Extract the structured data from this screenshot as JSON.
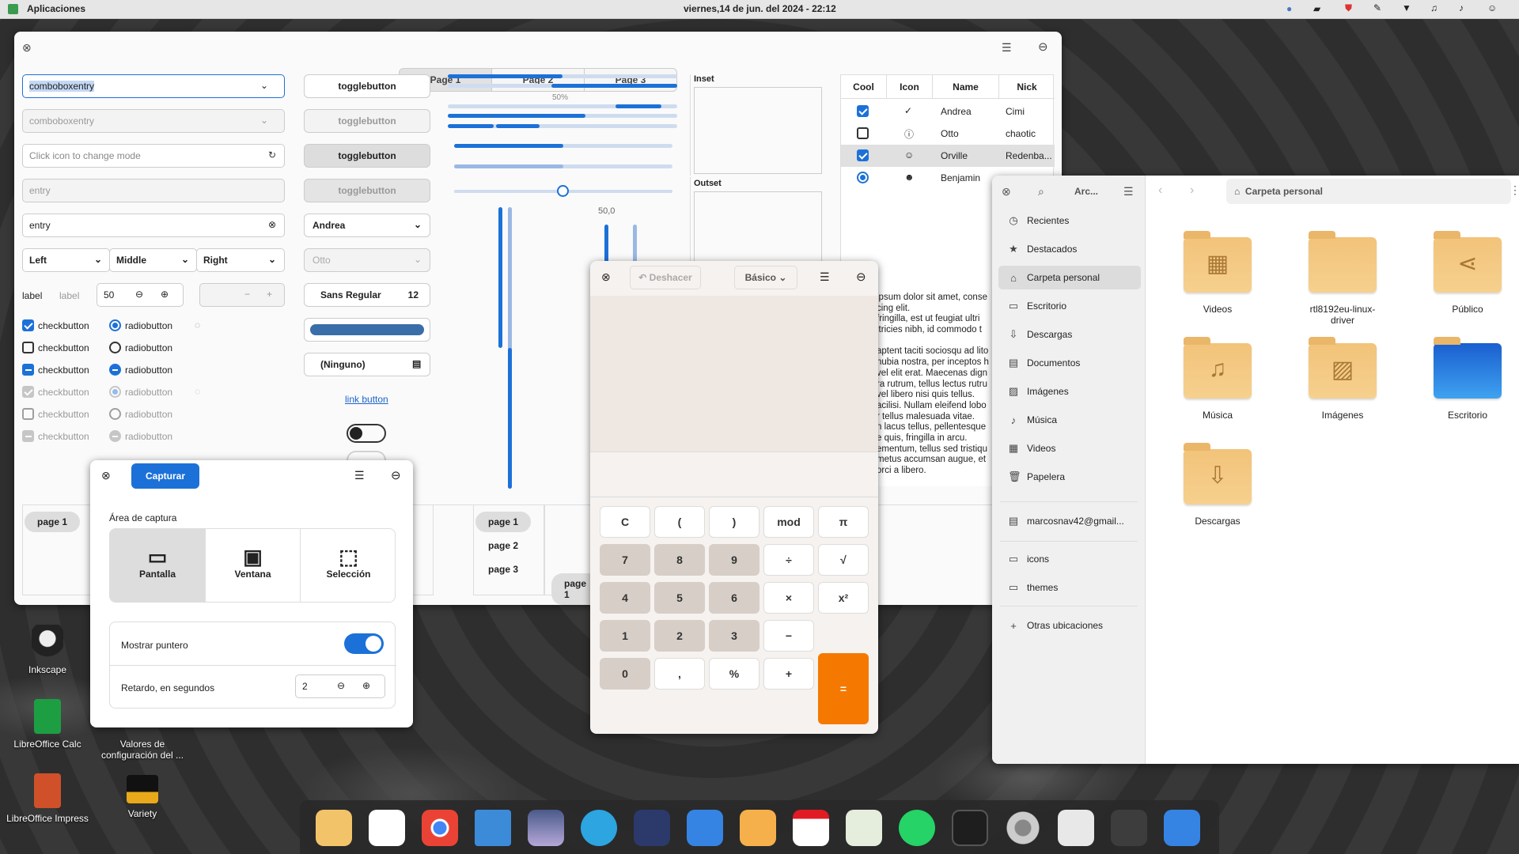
{
  "topbar": {
    "apps": "Aplicaciones",
    "datetime": "viernes,14 de jun. del 2024 - 22:12"
  },
  "gtk": {
    "tabs": [
      "Page 1",
      "Page 2",
      "Page 3"
    ],
    "combo1": "comboboxentry",
    "combo2": "comboboxentry",
    "mode_placeholder": "Click icon to change mode",
    "entry_ph": "entry",
    "entry_val": "entry",
    "segments": [
      "Left",
      "Middle",
      "Right"
    ],
    "label1": "label",
    "label2": "label",
    "spin_val": "50",
    "check": "checkbutton",
    "radio": "radiobutton",
    "toggle": "togglebutton",
    "combo_a": "Andrea",
    "combo_o": "Otto",
    "font_name": "Sans Regular",
    "font_size": "12",
    "none": "(Ninguno)",
    "link": "link button",
    "progress_label": "50%",
    "scale_label": "50,0",
    "inset": "Inset",
    "outset": "Outset",
    "tree_headers": [
      "Cool",
      "Icon",
      "Name",
      "Nick"
    ],
    "tree_rows": [
      {
        "name": "Andrea",
        "nick": "Cimi"
      },
      {
        "name": "Otto",
        "nick": "chaotic"
      },
      {
        "name": "Orville",
        "nick": "Redenba..."
      },
      {
        "name": "Benjamin",
        "nick": ""
      }
    ],
    "text_lines": [
      "ipsum dolor sit amet, conse",
      "cing elit.",
      "fringilla, est ut feugiat ultri",
      "ltricies nibh, id commodo t",
      "",
      "aptent taciti sociosqu ad lito",
      "nubia nostra, per inceptos h",
      "vel elit erat. Maecenas dign",
      "ra rutrum, tellus lectus rutru",
      "vel libero nisi quis tellus.",
      "acilisi. Nullam eleifend lobo",
      "r tellus malesuada vitae.",
      "n lacus tellus, pellentesque",
      "e quis, fringilla in arcu.",
      "ementum, tellus sed tristiqu",
      "metus accumsan augue, et",
      "orci a libero."
    ],
    "pages": [
      "page 1",
      "page 2",
      "page 3"
    ]
  },
  "shot": {
    "capture": "Capturar",
    "area": "Área de captura",
    "modes": [
      "Pantalla",
      "Ventana",
      "Selección"
    ],
    "pointer": "Mostrar puntero",
    "delay": "Retardo, en segundos",
    "delay_val": "2"
  },
  "calc": {
    "undo": "Deshacer",
    "mode": "Básico",
    "keys": [
      [
        "C",
        "(",
        ")",
        "mod",
        "π"
      ],
      [
        "7",
        "8",
        "9",
        "÷",
        "√"
      ],
      [
        "4",
        "5",
        "6",
        "×",
        "x²"
      ],
      [
        "1",
        "2",
        "3",
        "−"
      ],
      [
        "0",
        ",",
        "%",
        "+"
      ]
    ],
    "equals": "="
  },
  "files": {
    "title": "Arc...",
    "path": "Carpeta personal",
    "nav": [
      {
        "icon": "◷",
        "label": "Recientes"
      },
      {
        "icon": "★",
        "label": "Destacados"
      },
      {
        "icon": "⌂",
        "label": "Carpeta personal"
      },
      {
        "icon": "▭",
        "label": "Escritorio"
      },
      {
        "icon": "⇩",
        "label": "Descargas"
      },
      {
        "icon": "▤",
        "label": "Documentos"
      },
      {
        "icon": "▨",
        "label": "Imágenes"
      },
      {
        "icon": "♪",
        "label": "Música"
      },
      {
        "icon": "▦",
        "label": "Videos"
      },
      {
        "icon": "🗑",
        "label": "Papelera"
      }
    ],
    "account": "marcosnav42@gmail...",
    "bookmarks": [
      "icons",
      "themes"
    ],
    "other": "Otras ubicaciones",
    "folders": [
      {
        "icon": "▦",
        "label": "Videos"
      },
      {
        "icon": "",
        "label": "rtl8192eu-linux-driver"
      },
      {
        "icon": "⋖",
        "label": "Público"
      },
      {
        "icon": "♫",
        "label": "Música"
      },
      {
        "icon": "▨",
        "label": "Imágenes"
      },
      {
        "icon": "",
        "label": "Escritorio"
      },
      {
        "icon": "⇩",
        "label": "Descargas"
      }
    ]
  },
  "desktop": [
    "Inkscape",
    "LibreOffice Calc",
    "Valores de configuración del ...",
    "LibreOffice Impress",
    "Variety"
  ]
}
